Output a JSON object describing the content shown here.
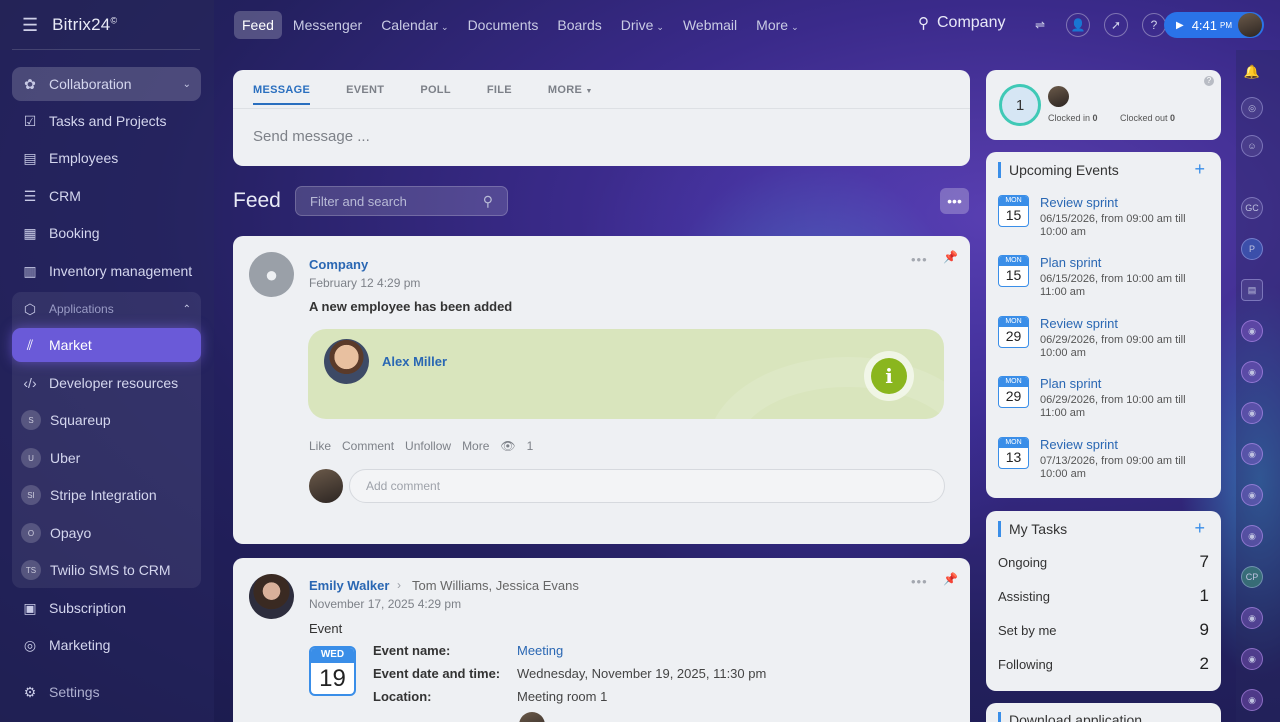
{
  "app": {
    "logo": "Bitrix24",
    "logo_mark": "©"
  },
  "topnav": {
    "items": [
      {
        "label": "Feed",
        "active": true
      },
      {
        "label": "Messenger"
      },
      {
        "label": "Calendar",
        "chevron": true
      },
      {
        "label": "Documents"
      },
      {
        "label": "Boards"
      },
      {
        "label": "Drive",
        "chevron": true
      },
      {
        "label": "Webmail"
      },
      {
        "label": "More",
        "chevron": true
      }
    ],
    "search_label": "Company",
    "clock": {
      "time": "4:41",
      "ampm": "PM"
    }
  },
  "sidebar": {
    "collaboration": "Collaboration",
    "items": [
      "Tasks and Projects",
      "Employees",
      "CRM",
      "Booking",
      "Inventory management"
    ],
    "applications_label": "Applications",
    "market": "Market",
    "developer": "Developer resources",
    "apps": [
      {
        "initials": "S",
        "label": "Squareup"
      },
      {
        "initials": "U",
        "label": "Uber"
      },
      {
        "initials": "SI",
        "label": "Stripe Integration"
      },
      {
        "initials": "O",
        "label": "Opayo"
      },
      {
        "initials": "TS",
        "label": "Twilio SMS to CRM"
      }
    ],
    "subscription": "Subscription",
    "marketing": "Marketing",
    "settings": "Settings"
  },
  "composer": {
    "tabs": [
      "MESSAGE",
      "EVENT",
      "POLL",
      "FILE",
      "MORE"
    ],
    "placeholder": "Send message ..."
  },
  "feed": {
    "title": "Feed",
    "filter_placeholder": "Filter and search",
    "more": "•••"
  },
  "post1": {
    "author": "Company",
    "date": "February 12 4:29 pm",
    "text": "A new employee has been added",
    "employee": "Alex Miller",
    "info_icon": "i",
    "actions": [
      "Like",
      "Comment",
      "Unfollow",
      "More"
    ],
    "views": "1",
    "comment_placeholder": "Add comment"
  },
  "post2": {
    "author": "Emily Walker",
    "recipients": "Tom Williams, Jessica Evans",
    "date": "November 17, 2025 4:29 pm",
    "type": "Event",
    "cal_month": "WED",
    "cal_day": "19",
    "rows": [
      {
        "key": "Event name:",
        "value": "Meeting",
        "link": true
      },
      {
        "key": "Event date and time:",
        "value": "Wednesday, November 19, 2025, 11:30 pm"
      },
      {
        "key": "Location:",
        "value": "Meeting room 1"
      }
    ]
  },
  "worktime": {
    "count": "1",
    "clocked_in_label": "Clocked in",
    "clocked_in": "0",
    "clocked_out_label": "Clocked out",
    "clocked_out": "0"
  },
  "upcoming": {
    "title": "Upcoming Events",
    "events": [
      {
        "month": "MON",
        "day": "15",
        "title": "Review sprint",
        "time": "06/15/2026, from 09:00 am till 10:00 am"
      },
      {
        "month": "MON",
        "day": "15",
        "title": "Plan sprint",
        "time": "06/15/2026, from 10:00 am till 11:00 am"
      },
      {
        "month": "MON",
        "day": "29",
        "title": "Review sprint",
        "time": "06/29/2026, from 09:00 am till 10:00 am"
      },
      {
        "month": "MON",
        "day": "29",
        "title": "Plan sprint",
        "time": "06/29/2026, from 10:00 am till 11:00 am"
      },
      {
        "month": "MON",
        "day": "13",
        "title": "Review sprint",
        "time": "07/13/2026, from 09:00 am till 10:00 am"
      }
    ]
  },
  "tasks": {
    "title": "My Tasks",
    "rows": [
      {
        "label": "Ongoing",
        "count": "7"
      },
      {
        "label": "Assisting",
        "count": "1"
      },
      {
        "label": "Set by me",
        "count": "9"
      },
      {
        "label": "Following",
        "count": "2"
      }
    ]
  },
  "download": {
    "title": "Download application"
  },
  "rightbar": {
    "initials": [
      "GC",
      "P",
      "CP"
    ]
  }
}
